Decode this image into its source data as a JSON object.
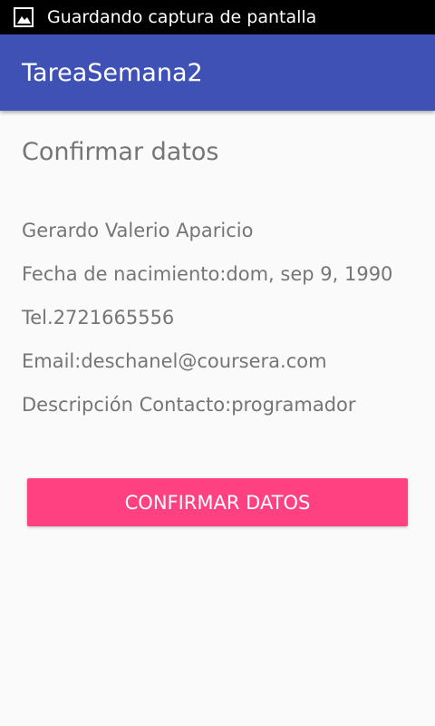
{
  "status_bar": {
    "notification_icon": "image-icon",
    "text": "Guardando captura de pantalla"
  },
  "app_bar": {
    "title": "TareaSemana2",
    "color": "#3f51b5"
  },
  "main": {
    "heading": "Confirmar datos",
    "name": "Gerardo Valerio Aparicio",
    "birth_date": "Fecha de nacimiento:dom, sep 9, 1990",
    "phone": "Tel.2721665556",
    "email": "Email:deschanel@coursera.com",
    "description": "Descripción Contacto:programador",
    "confirm_button_label": "CONFIRMAR DATOS",
    "button_color": "#ff4081"
  }
}
